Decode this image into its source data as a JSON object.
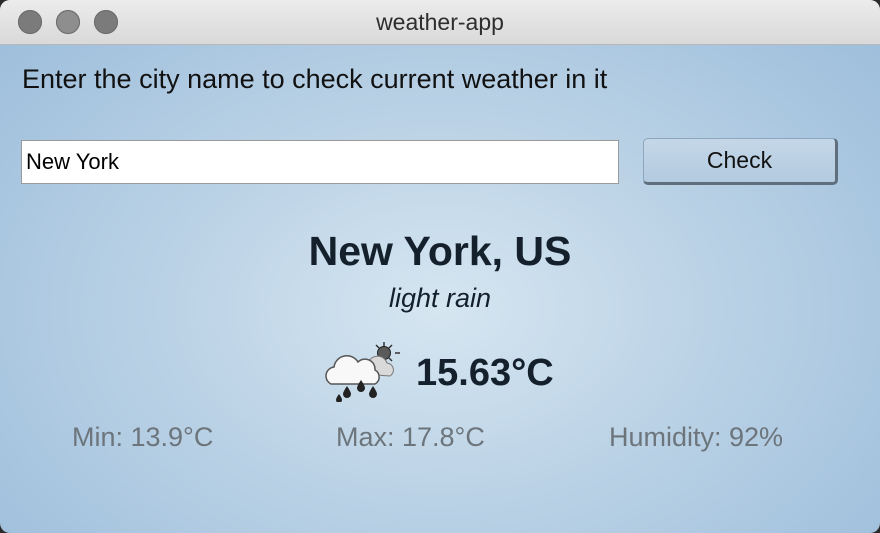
{
  "window": {
    "title": "weather-app"
  },
  "form": {
    "instruction": "Enter the city name to check current weather in it",
    "city_value": "New York",
    "check_label": "Check"
  },
  "result": {
    "location": "New York, US",
    "description": "light rain",
    "icon": "cloud-rain-sun-icon",
    "temperature": "15.63°C",
    "min": "Min: 13.9°C",
    "max": "Max: 17.8°C",
    "humidity": "Humidity: 92%"
  },
  "colors": {
    "background_light": "#d6e6f1",
    "background_dark": "#9fbfdc",
    "heading_text": "#14202c",
    "muted_text": "#6d757c"
  }
}
